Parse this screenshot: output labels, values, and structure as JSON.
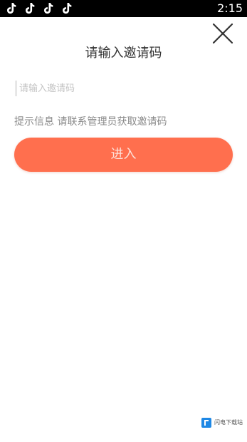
{
  "status_bar": {
    "time": "2:15",
    "notification_icons": [
      "tiktok-icon",
      "tiktok-icon",
      "tiktok-icon",
      "tiktok-icon"
    ],
    "background_color": "#000000"
  },
  "dialog": {
    "close_icon": "close-icon",
    "title": "请输入邀请码",
    "input": {
      "value": "",
      "placeholder": "请输入邀请码"
    },
    "hint": "提示信息 请联系管理员获取邀请码",
    "enter_label": "进入",
    "accent_color": "#ff6f4e"
  },
  "watermark": {
    "text": "闪电下载站"
  }
}
